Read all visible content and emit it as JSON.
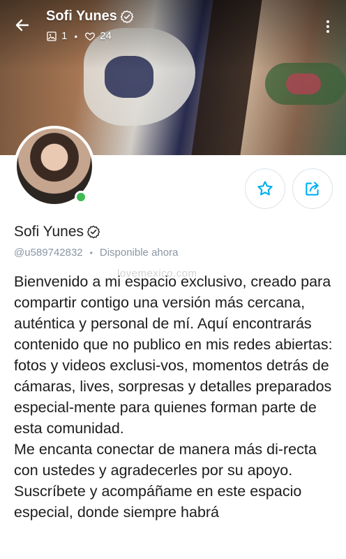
{
  "header": {
    "title": "Sofi Yunes",
    "media_count": "1",
    "likes_count": "24",
    "back_icon": "arrow-left-icon",
    "menu_icon": "more-vertical-icon"
  },
  "profile": {
    "name": "Sofi Yunes",
    "handle": "@u589742832",
    "status": "Disponible ahora",
    "online": true
  },
  "actions": {
    "favorite_icon": "star-icon",
    "share_icon": "share-icon"
  },
  "bio": {
    "paragraph1": "Bienvenido a mi espacio exclusivo, creado para compartir contigo una versión más cercana, auténtica y personal de mí. Aquí encontrarás contenido que no publico en mis redes abiertas: fotos y videos exclusi-vos, momentos detrás de cámaras, lives, sorpresas y detalles preparados especial-mente para quienes forman parte de esta comunidad.",
    "paragraph2": "Me encanta conectar de manera más di-recta con ustedes y agradecerles por su apoyo. Suscríbete y acompáñame en este espacio especial, donde siempre habrá"
  },
  "watermark": "lovemexico.com",
  "colors": {
    "accent": "#00aff0",
    "online": "#3dbb52",
    "muted": "#8a96a3",
    "border": "#d9e3ea"
  }
}
